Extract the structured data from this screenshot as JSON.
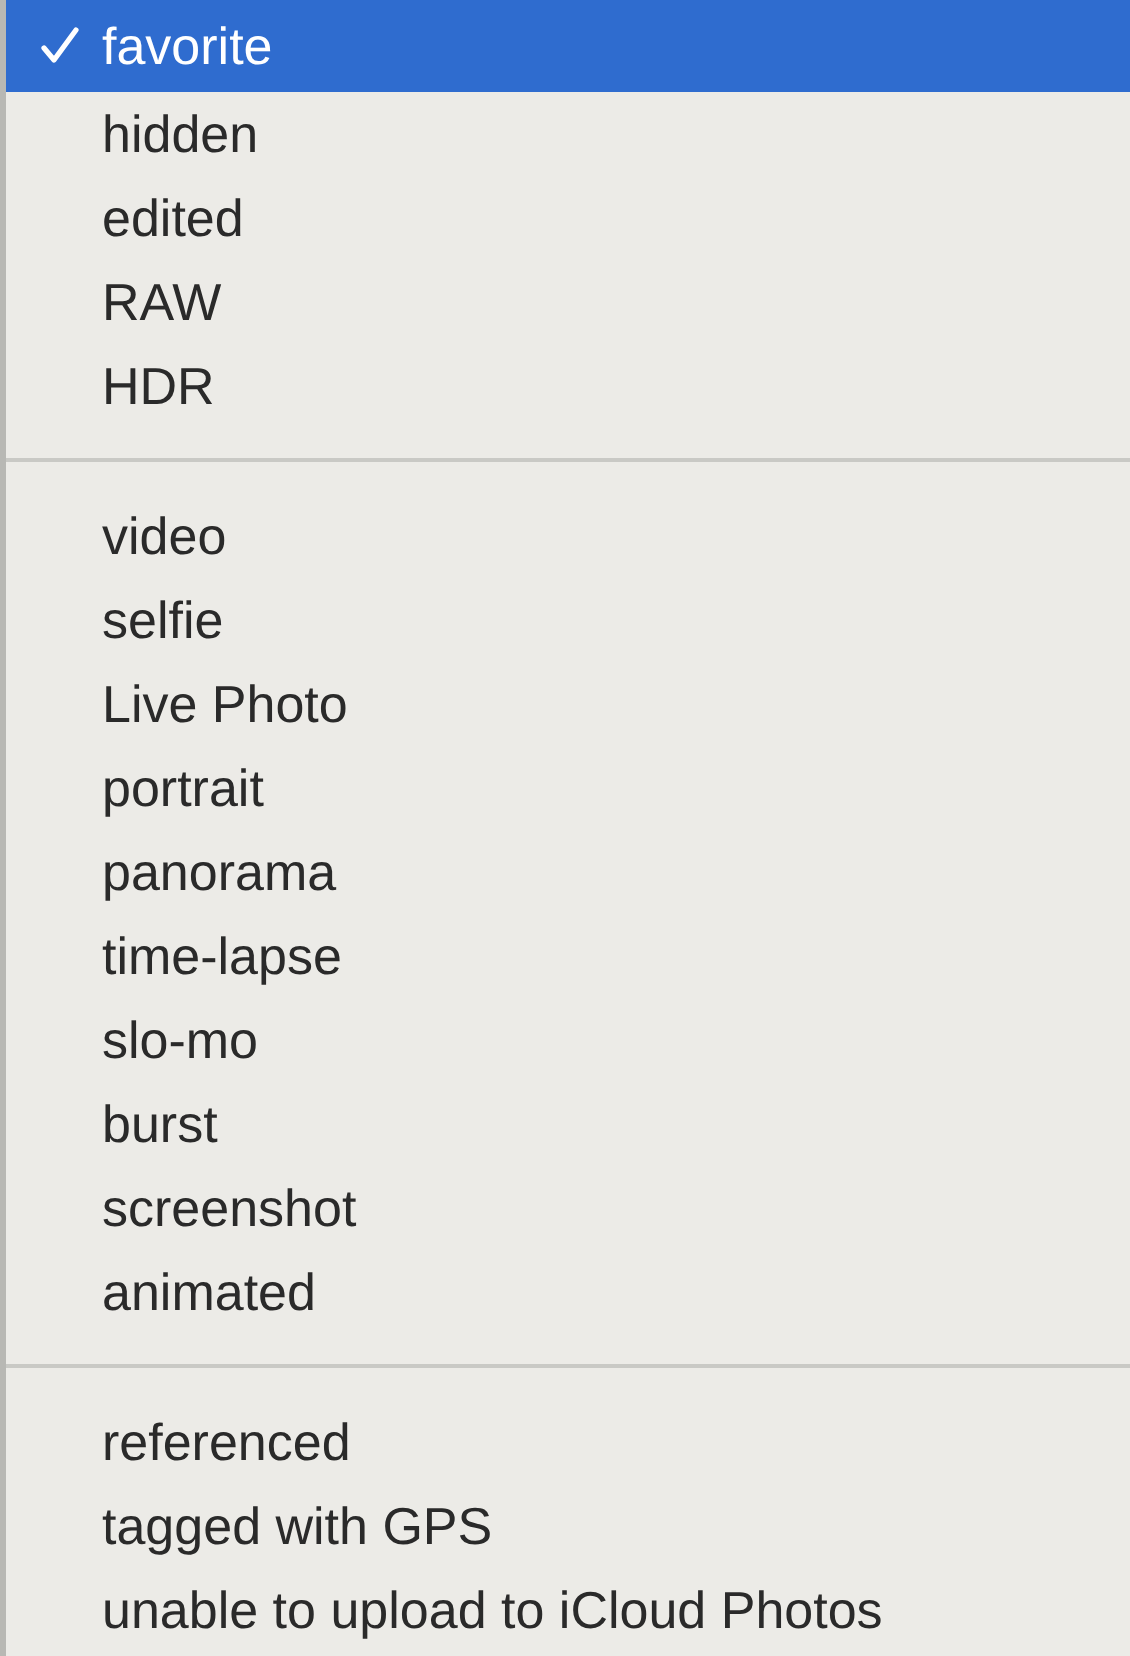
{
  "menu": {
    "sections": [
      {
        "items": [
          {
            "label": "favorite",
            "checked": true,
            "selected": true
          },
          {
            "label": "hidden",
            "checked": false,
            "selected": false
          },
          {
            "label": "edited",
            "checked": false,
            "selected": false
          },
          {
            "label": "RAW",
            "checked": false,
            "selected": false
          },
          {
            "label": "HDR",
            "checked": false,
            "selected": false
          }
        ]
      },
      {
        "items": [
          {
            "label": "video",
            "checked": false,
            "selected": false
          },
          {
            "label": "selfie",
            "checked": false,
            "selected": false
          },
          {
            "label": "Live Photo",
            "checked": false,
            "selected": false
          },
          {
            "label": "portrait",
            "checked": false,
            "selected": false
          },
          {
            "label": "panorama",
            "checked": false,
            "selected": false
          },
          {
            "label": "time-lapse",
            "checked": false,
            "selected": false
          },
          {
            "label": "slo-mo",
            "checked": false,
            "selected": false
          },
          {
            "label": "burst",
            "checked": false,
            "selected": false
          },
          {
            "label": "screenshot",
            "checked": false,
            "selected": false
          },
          {
            "label": "animated",
            "checked": false,
            "selected": false
          }
        ]
      },
      {
        "items": [
          {
            "label": "referenced",
            "checked": false,
            "selected": false
          },
          {
            "label": "tagged with GPS",
            "checked": false,
            "selected": false
          },
          {
            "label": "unable to upload to iCloud Photos",
            "checked": false,
            "selected": false
          }
        ]
      }
    ]
  }
}
